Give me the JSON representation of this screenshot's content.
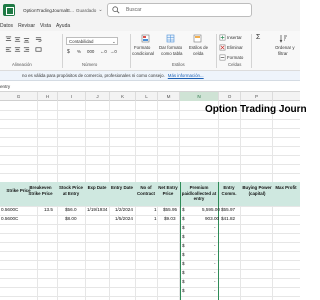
{
  "titlebar": {
    "doc_title": "OptionTradingJournalE...",
    "saved_state": "Guardado",
    "chevron": "⌄",
    "search_placeholder": "Buscar"
  },
  "menu": [
    "Datos",
    "Revisar",
    "Vista",
    "Ayuda"
  ],
  "ribbon": {
    "font_size": "11",
    "number_format": "Contabilidad",
    "percent": "%",
    "thousands": "000",
    "conditional_format": [
      "Formato",
      "condicional"
    ],
    "format_table": [
      "Dar formato",
      "como tabla"
    ],
    "cell_styles": [
      "Estilos de",
      "celda"
    ],
    "insert": "Insertar",
    "delete": "Eliminar",
    "format": "Formato",
    "sort_filter": [
      "Ordenar y",
      "filtrar"
    ],
    "groups": {
      "alignment": "Alineación",
      "number": "Número",
      "styles": "Estilos",
      "cells": "Celdas"
    }
  },
  "infobar": {
    "text": "no es válida para propósitos de comercio, profesionales ni como consejo.",
    "link": "Más información..."
  },
  "formula": {
    "text": "entry"
  },
  "columns": [
    "G",
    "H",
    "I",
    "J",
    "K",
    "L",
    "M",
    "N",
    "O",
    "P"
  ],
  "selected_column": "N",
  "sheet": {
    "heading": "Option Trading Journ",
    "headers": [
      [
        "Strike Price"
      ],
      [
        "Breakeven",
        "Strike Price"
      ],
      [
        "Stock Price",
        "at Entry"
      ],
      [
        "Exp Date"
      ],
      [
        "Entry Date"
      ],
      [
        "No of",
        "Contract"
      ],
      [
        "Net Entry",
        "Price"
      ],
      [
        "Premium",
        "paid/collected at",
        "entry"
      ],
      [
        "Entry",
        "Comm."
      ],
      [
        "Buying Power",
        "(capital)"
      ],
      [
        "Max Profit"
      ]
    ],
    "rows": [
      {
        "a": "0.5600C",
        "b": "13.5",
        "c": "$56.0",
        "d": "1/19/1934",
        "e": "1/2/2024",
        "f": "1",
        "g": "$55.95",
        "h_sym": "$",
        "h": "5,595.00",
        "i": "$55.97"
      },
      {
        "a": "0.5600C",
        "b": "",
        "c": "$8.00",
        "d": "",
        "e": "1/5/2024",
        "f": "1",
        "g": "$9.03",
        "h_sym": "$",
        "h": "903.00",
        "i": "$41.82"
      },
      {
        "h_sym": "$",
        "h": "-"
      },
      {
        "h_sym": "$",
        "h": "-"
      },
      {
        "h_sym": "$",
        "h": "-"
      },
      {
        "h_sym": "$",
        "h": "-"
      },
      {
        "h_sym": "$",
        "h": "-"
      },
      {
        "h_sym": "$",
        "h": "-"
      },
      {
        "h_sym": "$",
        "h": "-"
      },
      {
        "h_sym": "$",
        "h": "-"
      }
    ]
  }
}
